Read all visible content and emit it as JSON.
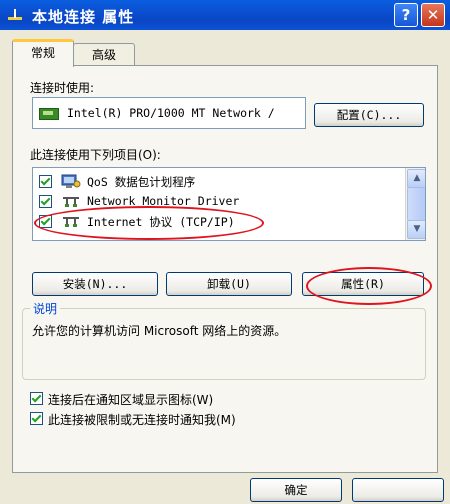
{
  "window": {
    "title": "本地连接 属性",
    "help_glyph": "?",
    "close_glyph": "✕"
  },
  "tabs": [
    {
      "label": "常规",
      "active": true
    },
    {
      "label": "高级",
      "active": false
    }
  ],
  "connect_using": {
    "label": "连接时使用:",
    "adapter": "Intel(R) PRO/1000 MT Network /",
    "configure_button": "配置(C)..."
  },
  "components": {
    "label": "此连接使用下列项目(O):",
    "items": [
      {
        "label": "QoS 数据包计划程序",
        "checked": true,
        "icon": "qos-scheduler-icon"
      },
      {
        "label": "Network Monitor Driver",
        "checked": true,
        "icon": "network-protocol-icon"
      },
      {
        "label": "Internet 协议 (TCP/IP)",
        "checked": true,
        "icon": "network-protocol-icon"
      }
    ],
    "scroll_up": "▲",
    "scroll_down": "▼"
  },
  "buttons": {
    "install": "安装(N)...",
    "uninstall": "卸载(U)",
    "properties": "属性(R)"
  },
  "description": {
    "title": "说明",
    "text": "允许您的计算机访问 Microsoft 网络上的资源。"
  },
  "options": [
    {
      "label": "连接后在通知区域显示图标(W)",
      "checked": true
    },
    {
      "label": "此连接被限制或无连接时通知我(M)",
      "checked": true
    }
  ],
  "footer": {
    "ok_button": "确定"
  },
  "colors": {
    "titlebar": "#0a4fd0",
    "panel": "#f7f6f0",
    "annotation": "#e0141f",
    "group_title": "#0046d5"
  }
}
